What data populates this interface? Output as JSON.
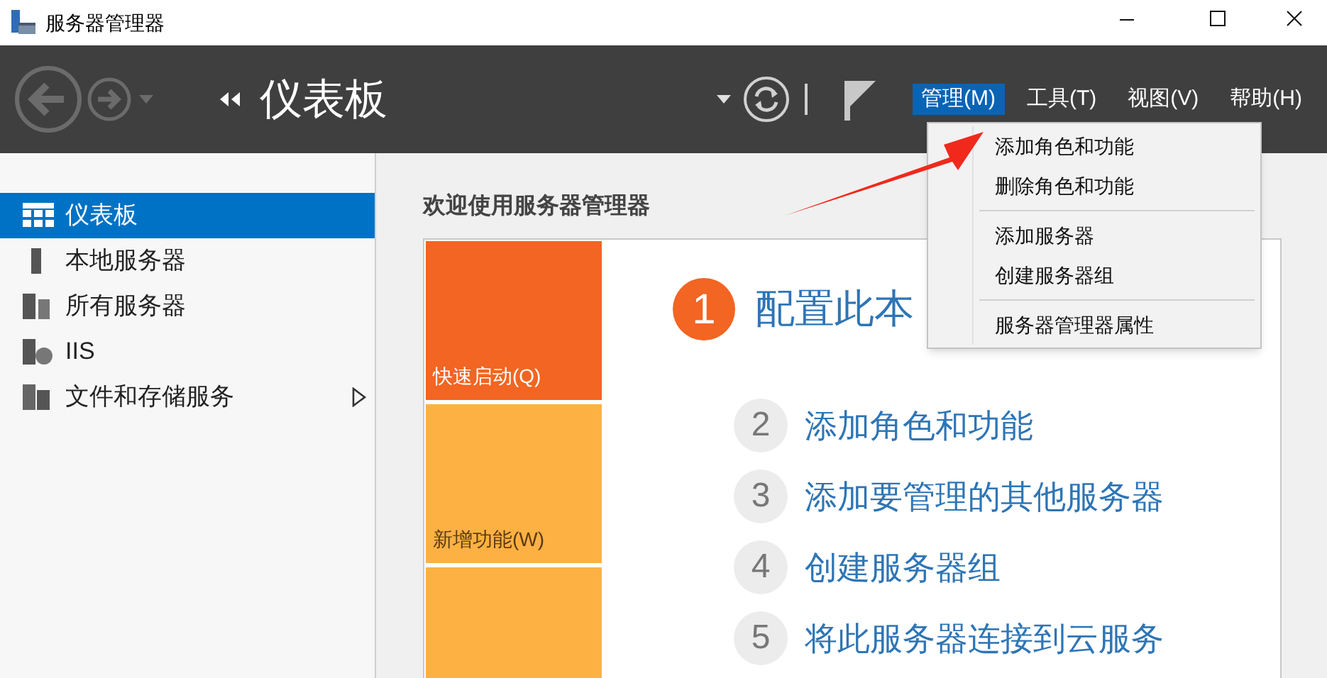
{
  "window": {
    "title": "服务器管理器"
  },
  "header": {
    "title": "仪表板",
    "menu": [
      {
        "label": "管理(M)",
        "selected": true
      },
      {
        "label": "工具(T)",
        "selected": false
      },
      {
        "label": "视图(V)",
        "selected": false
      },
      {
        "label": "帮助(H)",
        "selected": false
      }
    ]
  },
  "dropdown": {
    "groups": [
      [
        "添加角色和功能",
        "删除角色和功能"
      ],
      [
        "添加服务器",
        "创建服务器组"
      ],
      [
        "服务器管理器属性"
      ]
    ]
  },
  "sidebar": {
    "items": [
      {
        "label": "仪表板",
        "selected": true,
        "has_submenu": false
      },
      {
        "label": "本地服务器",
        "selected": false,
        "has_submenu": false
      },
      {
        "label": "所有服务器",
        "selected": false,
        "has_submenu": false
      },
      {
        "label": "IIS",
        "selected": false,
        "has_submenu": false
      },
      {
        "label": "文件和存储服务",
        "selected": false,
        "has_submenu": true
      }
    ]
  },
  "welcome": {
    "heading": "欢迎使用服务器管理器",
    "tiles": [
      {
        "label": "快速启动(Q)",
        "color": "#f26522"
      },
      {
        "label": "新增功能(W)",
        "color": "#fdb143"
      },
      {
        "color": "#fdb143"
      }
    ],
    "steps": [
      {
        "number": "1",
        "text": "配置此本",
        "kind": "primary"
      },
      {
        "number": "2",
        "text": "添加角色和功能",
        "kind": "secondary"
      },
      {
        "number": "3",
        "text": "添加要管理的其他服务器",
        "kind": "secondary"
      },
      {
        "number": "4",
        "text": "创建服务器组",
        "kind": "secondary"
      },
      {
        "number": "5",
        "text": "将此服务器连接到云服务",
        "kind": "secondary"
      }
    ]
  }
}
